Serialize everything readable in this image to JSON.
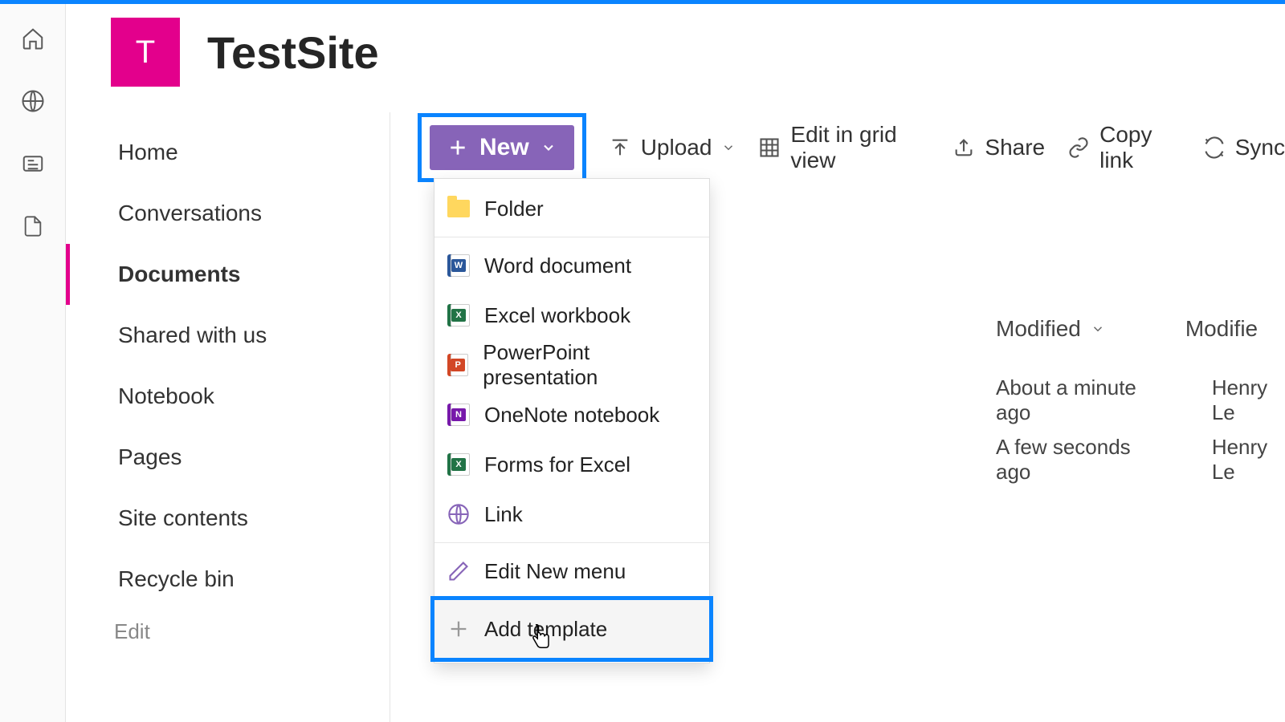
{
  "site": {
    "logo_letter": "T",
    "title": "TestSite"
  },
  "nav": {
    "items": [
      {
        "label": "Home"
      },
      {
        "label": "Conversations"
      },
      {
        "label": "Documents",
        "active": true
      },
      {
        "label": "Shared with us"
      },
      {
        "label": "Notebook"
      },
      {
        "label": "Pages"
      },
      {
        "label": "Site contents"
      },
      {
        "label": "Recycle bin"
      }
    ],
    "edit_label": "Edit"
  },
  "toolbar": {
    "new_label": "New",
    "upload_label": "Upload",
    "grid_label": "Edit in grid view",
    "share_label": "Share",
    "copylink_label": "Copy link",
    "sync_label": "Sync"
  },
  "dropdown": {
    "folder": "Folder",
    "word": "Word document",
    "excel": "Excel workbook",
    "ppt": "PowerPoint presentation",
    "onenote": "OneNote notebook",
    "forms": "Forms for Excel",
    "link": "Link",
    "editmenu": "Edit New menu",
    "addtemplate": "Add template"
  },
  "columns": {
    "modified": "Modified",
    "modifiedby_partial": "Modifie"
  },
  "rows": [
    {
      "modified": "About a minute ago",
      "by": "Henry Le"
    },
    {
      "modified": "A few seconds ago",
      "by": "Henry Le"
    }
  ]
}
